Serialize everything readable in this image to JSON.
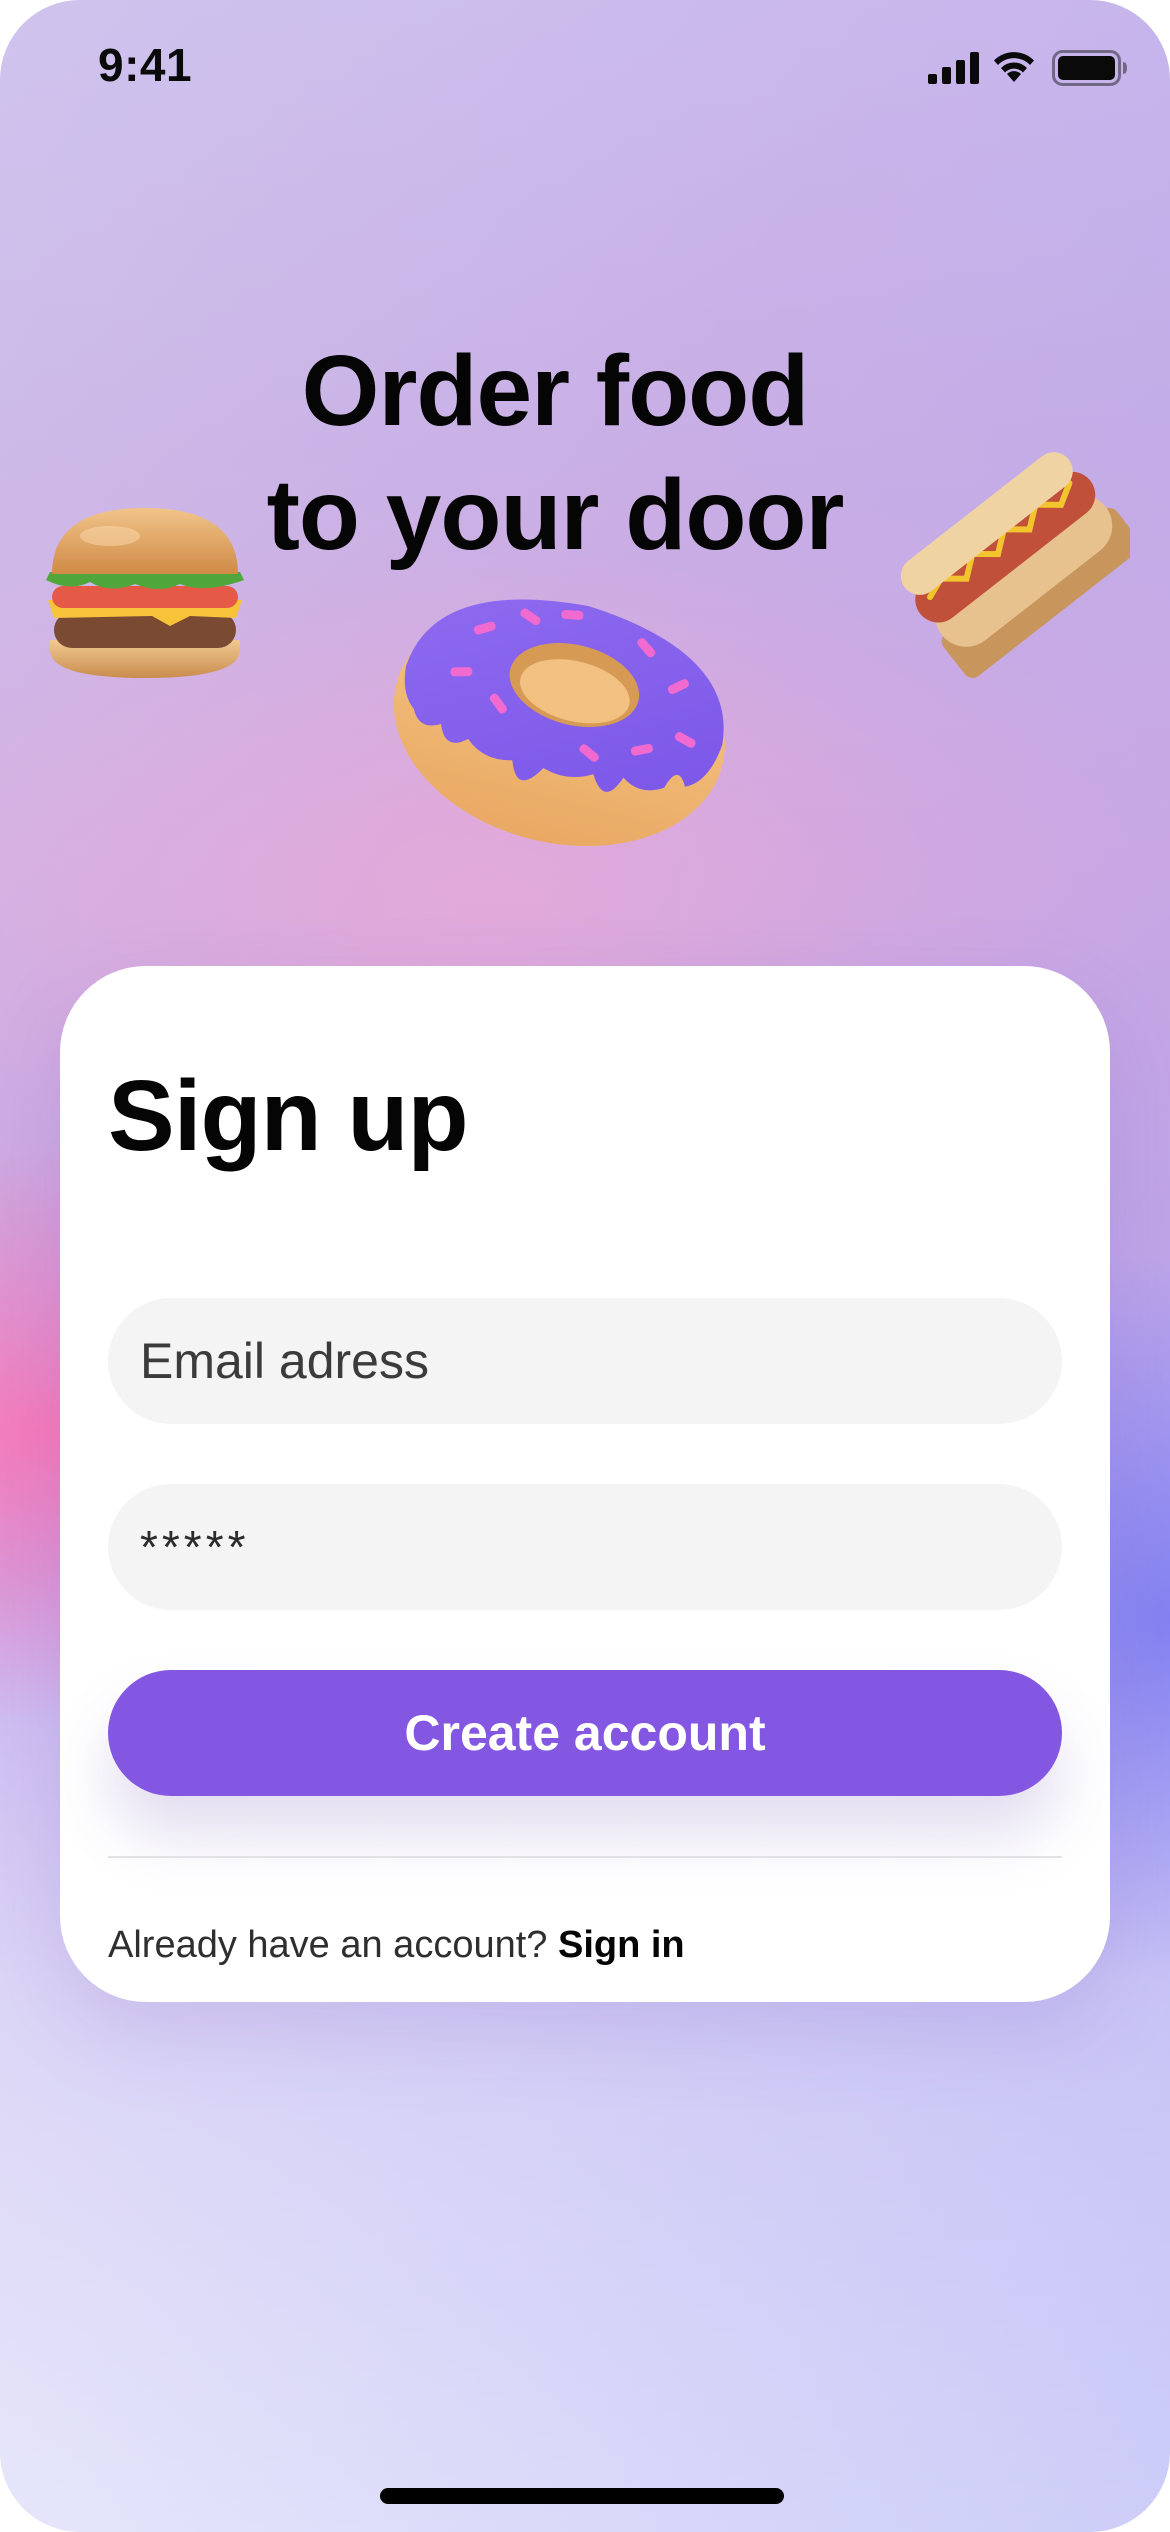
{
  "status_bar": {
    "time": "9:41"
  },
  "hero": {
    "title_line1": "Order food",
    "title_line2": "to your door"
  },
  "food_icons": [
    "burger-icon",
    "donut-icon",
    "hotdog-icon"
  ],
  "signup": {
    "title": "Sign up",
    "email_placeholder": "Email adress",
    "password_value": "*****",
    "create_button": "Create account",
    "signin_prompt": "Already have an account?",
    "signin_link": "Sign in"
  },
  "colors": {
    "accent": "#8357e2",
    "field_background": "#f4f4f5",
    "card_background": "#ffffff"
  }
}
